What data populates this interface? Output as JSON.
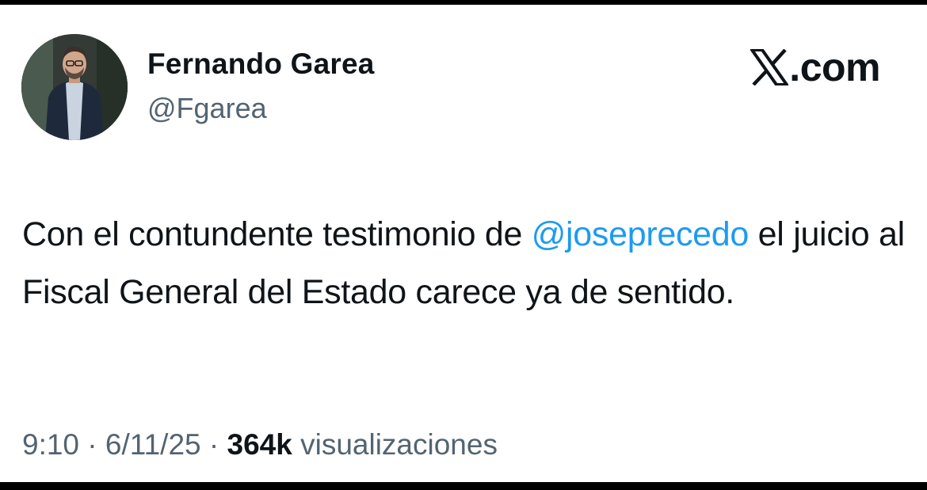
{
  "author": {
    "name": "Fernando Garea",
    "handle": "@Fgarea",
    "avatar_icon": "profile-photo"
  },
  "brand": {
    "icon": "x-logo-icon",
    "text": ".com"
  },
  "tweet": {
    "text_before": "Con el contundente testimonio de ",
    "mention": "@joseprecedo",
    "text_after": " el juicio al Fiscal General del Estado carece ya de sentido."
  },
  "meta": {
    "time": "9:10",
    "separator": "·",
    "date": "6/11/25",
    "views_count": "364k",
    "views_label": "visualizaciones"
  },
  "colors": {
    "mention": "#1d9bf0",
    "secondary_text": "#536471",
    "primary_text": "#0f1419",
    "frame": "#000000"
  }
}
